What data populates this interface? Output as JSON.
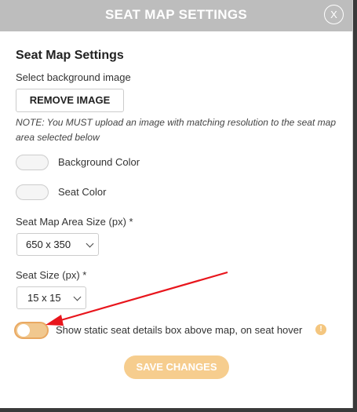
{
  "modal": {
    "title": "SEAT MAP SETTINGS",
    "close_label": "X"
  },
  "section": {
    "title": "Seat Map Settings",
    "background_image_label": "Select background image",
    "remove_image_label": "REMOVE IMAGE",
    "note": "NOTE: You MUST upload an image with matching resolution to the seat map area selected below"
  },
  "colors": {
    "background_color_label": "Background Color",
    "seat_color_label": "Seat Color"
  },
  "area_size": {
    "label": "Seat Map Area Size (px) *",
    "selected": "650 x 350"
  },
  "seat_size": {
    "label": "Seat Size (px) *",
    "selected": "15 x 15"
  },
  "hover_toggle": {
    "label": "Show static seat details box above map, on seat hover",
    "enabled": false,
    "info_icon_glyph": "!"
  },
  "footer": {
    "save_label": "SAVE CHANGES"
  },
  "theme": {
    "accent": "#f6cd8e",
    "header_bg": "#bdbdbd",
    "arrow_color": "#e8151c"
  },
  "icons": {
    "close": "close-icon",
    "chevron": "chevron-down-icon",
    "info": "info-icon",
    "arrow": "red-arrow-annotation"
  }
}
